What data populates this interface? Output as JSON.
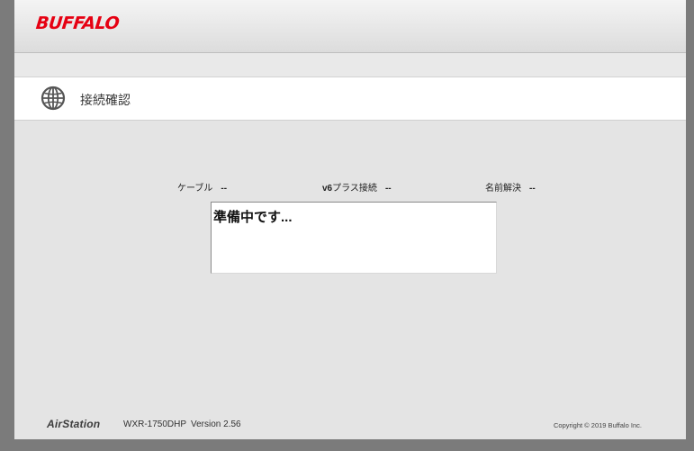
{
  "header": {
    "brand": "BUFFALO"
  },
  "page": {
    "title": "接続確認",
    "title_icon": "globe-icon"
  },
  "status": {
    "cable_label": "ケーブル",
    "cable_value": "--",
    "v6plus_prefix": "v6",
    "v6plus_label": "プラス接続",
    "v6plus_value": "--",
    "dns_label": "名前解決",
    "dns_value": "--"
  },
  "message": {
    "text": "準備中です..."
  },
  "footer": {
    "product": "AirStation",
    "model": "WXR-1750DHP",
    "version": "Version 2.56",
    "copyright": "Copyright © 2019 Buffalo Inc."
  },
  "colors": {
    "brand": "#e60012",
    "background": "#e4e4e4",
    "frame": "#7b7b7b"
  }
}
